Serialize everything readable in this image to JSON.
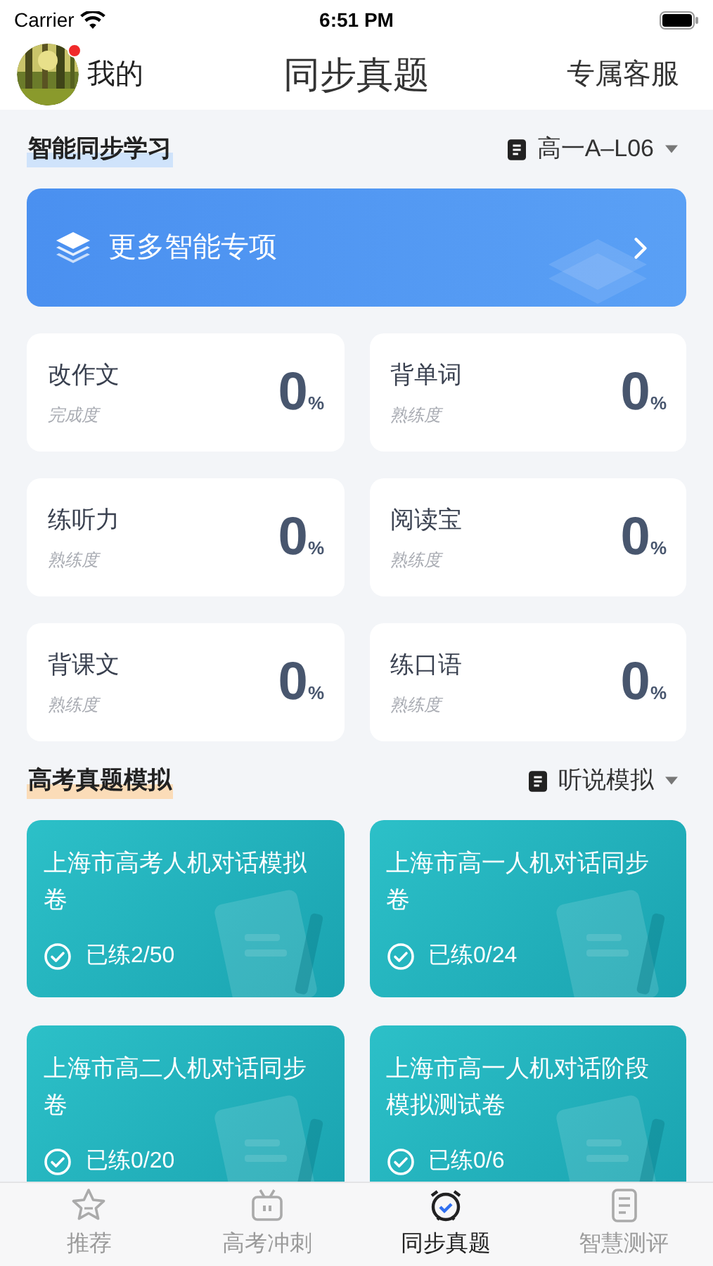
{
  "status_bar": {
    "carrier": "Carrier",
    "time": "6:51 PM"
  },
  "header": {
    "profile_label": "我的",
    "has_notification": true,
    "title": "同步真题",
    "service_link": "专属客服"
  },
  "sync_section": {
    "title": "智能同步学习",
    "selector": "高一A–L06"
  },
  "banner": {
    "label": "更多智能专项"
  },
  "skills": [
    {
      "name": "改作文",
      "caption": "完成度",
      "value": "0",
      "unit": "%"
    },
    {
      "name": "背单词",
      "caption": "熟练度",
      "value": "0",
      "unit": "%"
    },
    {
      "name": "练听力",
      "caption": "熟练度",
      "value": "0",
      "unit": "%"
    },
    {
      "name": "阅读宝",
      "caption": "熟练度",
      "value": "0",
      "unit": "%"
    },
    {
      "name": "背课文",
      "caption": "熟练度",
      "value": "0",
      "unit": "%"
    },
    {
      "name": "练口语",
      "caption": "熟练度",
      "value": "0",
      "unit": "%"
    }
  ],
  "exam_section": {
    "title": "高考真题模拟",
    "selector": "听说模拟"
  },
  "exams": [
    {
      "title": "上海市高考人机对话模拟卷",
      "progress": "已练2/50"
    },
    {
      "title": "上海市高一人机对话同步卷",
      "progress": "已练0/24"
    },
    {
      "title": "上海市高二人机对话同步卷",
      "progress": "已练0/20"
    },
    {
      "title": "上海市高一人机对话阶段模拟测试卷",
      "progress": "已练0/6"
    }
  ],
  "tabs": [
    {
      "label": "推荐",
      "selected": false
    },
    {
      "label": "高考冲刺",
      "selected": false
    },
    {
      "label": "同步真题",
      "selected": true
    },
    {
      "label": "智慧测评",
      "selected": false
    }
  ]
}
